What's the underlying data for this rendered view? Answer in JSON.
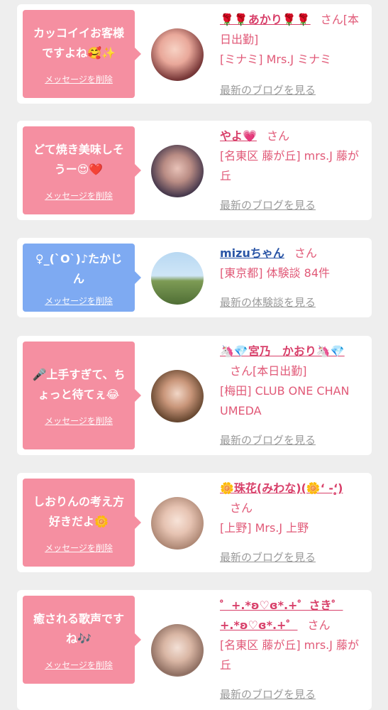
{
  "messages": [
    {
      "bubble_text": "カッコイイお客様ですよね🥰✨",
      "delete_label": "メッセージを削除",
      "name": "🌹🌹あかり🌹🌹",
      "san": "さん",
      "status": "[本日出勤]",
      "meta": "[ミナミ] Mrs.J ミナミ",
      "link": "最新のブログを見る"
    },
    {
      "bubble_text": "どて焼き美味しそうー😍❤️",
      "delete_label": "メッセージを削除",
      "name": "やよ💗",
      "san": "さん",
      "meta": "[名東区 藤が丘] mrs.J 藤が丘",
      "link": "最新のブログを見る"
    },
    {
      "bubble_text": "♀_(`O`)♪たかじん",
      "delete_label": "メッセージを削除",
      "name": "mizuちゃん",
      "san": "さん",
      "meta": "[東京都] 体験談 84件",
      "link": "最新の体験談を見る"
    },
    {
      "bubble_text": "🎤上手すぎて、ちょっと待てぇ😂",
      "delete_label": "メッセージを削除",
      "name": "🦄💎宮乃　かおり🦄💎",
      "san": "さん",
      "status": "[本日出勤]",
      "meta": "[梅田] CLUB ONE CHAN UMEDA",
      "link": "最新のブログを見る"
    },
    {
      "bubble_text": "しおりんの考え方好きだよ🌼",
      "delete_label": "メッセージを削除",
      "name": "🌼珠花(みわな)(🌼ʻ -ʻ̥̥̥)",
      "san": "さん",
      "meta": "[上野] Mrs.J 上野",
      "link": "最新のブログを見る"
    },
    {
      "bubble_text": "癒される歌声ですね🎶",
      "delete_label": "メッセージを削除",
      "name": "゜+.*ʚ♡ɞ*.+゜さき゜+.*ʚ♡ɞ*.+゜",
      "san": "さん",
      "meta": "[名東区 藤が丘] mrs.J 藤が丘",
      "link": "最新のブログを見る"
    }
  ],
  "colors": {
    "pink_bubble": "#f58fa1",
    "blue_bubble": "#7eaaf2",
    "name_pink": "#d8406a",
    "name_blue": "#2a55a6",
    "meta_pink": "#e15a78",
    "link_gray": "#9a9a9a"
  },
  "avatar_icons": [
    "selfie-photo",
    "selfie-photo",
    "road-landscape-photo",
    "selfie-photo",
    "selfie-photo",
    "selfie-photo"
  ]
}
